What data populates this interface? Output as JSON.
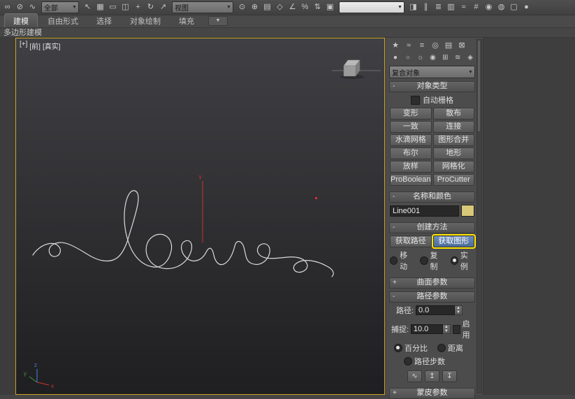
{
  "toolbar": {
    "group1": [
      {
        "name": "select-and-link-icon",
        "glyph": "∞"
      },
      {
        "name": "unlink-selection-icon",
        "glyph": "⊘"
      },
      {
        "name": "bind-to-space-warp-icon",
        "glyph": "∿"
      }
    ],
    "selection_filter": {
      "value": "全部"
    },
    "group2": [
      {
        "name": "select-object-icon",
        "glyph": "↖"
      },
      {
        "name": "select-by-name-icon",
        "glyph": "▦"
      },
      {
        "name": "selection-region-icon",
        "glyph": "▭"
      },
      {
        "name": "window-crossing-icon",
        "glyph": "◫"
      },
      {
        "name": "select-and-move-icon",
        "glyph": "+"
      },
      {
        "name": "select-and-rotate-icon",
        "glyph": "↻"
      },
      {
        "name": "select-and-scale-icon",
        "glyph": "↗"
      }
    ],
    "coord_system": {
      "value": "视图"
    },
    "group3a": [
      {
        "name": "use-pivot-center-icon",
        "glyph": "⊙"
      },
      {
        "name": "select-and-manipulate-icon",
        "glyph": "⊕"
      },
      {
        "name": "keyboard-override-icon",
        "glyph": "▤"
      },
      {
        "name": "snap-toggle-icon",
        "glyph": "◇"
      },
      {
        "name": "angle-snap-icon",
        "glyph": "∠"
      },
      {
        "name": "percent-snap-icon",
        "glyph": "%"
      },
      {
        "name": "spinner-snap-icon",
        "glyph": "⇅"
      },
      {
        "name": "named-sets-icon",
        "glyph": "▣"
      }
    ],
    "named_sets": {
      "value": ""
    },
    "group3b": [
      {
        "name": "mirror-icon",
        "glyph": "◨"
      },
      {
        "name": "align-icon",
        "glyph": "∥"
      },
      {
        "name": "layer-manager-icon",
        "glyph": "≣"
      },
      {
        "name": "ribbon-toggle-icon",
        "glyph": "▥"
      },
      {
        "name": "curve-editor-icon",
        "glyph": "≈"
      },
      {
        "name": "schematic-view-icon",
        "glyph": "#"
      },
      {
        "name": "material-editor-icon",
        "glyph": "◉"
      },
      {
        "name": "render-setup-icon",
        "glyph": "◍"
      },
      {
        "name": "rendered-frame-icon",
        "glyph": "▢"
      },
      {
        "name": "render-icon",
        "glyph": "●"
      }
    ]
  },
  "ribbon": {
    "tabs": [
      "建模",
      "自由形式",
      "选择",
      "对象绘制",
      "填充"
    ],
    "subtitle": "多边形建模"
  },
  "viewport": {
    "menu_plus": "[+]",
    "menu_view": "[前]",
    "menu_shading": "[真实]",
    "axis_x": "x",
    "axis_y": "y",
    "axis_z": "z",
    "pivot_axis": "Y"
  },
  "panel": {
    "tabs": [
      {
        "name": "tab-create",
        "glyph": "★"
      },
      {
        "name": "tab-modify",
        "glyph": "≈"
      },
      {
        "name": "tab-hierarchy",
        "glyph": "≡"
      },
      {
        "name": "tab-motion",
        "glyph": "◎"
      },
      {
        "name": "tab-display",
        "glyph": "▤"
      },
      {
        "name": "tab-utilities",
        "glyph": "⊠"
      }
    ],
    "categories": [
      {
        "name": "category-geometry-icon",
        "glyph": "●"
      },
      {
        "name": "category-shapes-icon",
        "glyph": "○"
      },
      {
        "name": "category-lights-icon",
        "glyph": "☼"
      },
      {
        "name": "category-cameras-icon",
        "glyph": "◉"
      },
      {
        "name": "category-helpers-icon",
        "glyph": "⊞"
      },
      {
        "name": "category-space-warps-icon",
        "glyph": "≋"
      },
      {
        "name": "category-systems-icon",
        "glyph": "◈"
      }
    ],
    "subcategory": "复合对象",
    "object_type": {
      "title": "对象类型",
      "autogrid_label": "自动栅格",
      "buttons": [
        "变形",
        "散布",
        "一致",
        "连接",
        "水滴网格",
        "图形合并",
        "布尔",
        "地形",
        "放样",
        "网格化",
        "ProBoolean",
        "ProCutter"
      ]
    },
    "name_color": {
      "title": "名称和颜色",
      "object_name": "Line001",
      "swatch_color": "#d8c878"
    },
    "creation_method": {
      "title": "创建方法",
      "get_path": "获取路径",
      "get_shape": "获取图形",
      "move": "移动",
      "copy": "复制",
      "instance": "实例",
      "selected": "实例"
    },
    "surface_params": {
      "title": "曲面参数"
    },
    "path_params": {
      "title": "路径参数",
      "path_label": "路径:",
      "path_value": "0.0",
      "snap_label": "捕捉:",
      "snap_value": "10.0",
      "enable_label": "启用",
      "percent_label": "百分比",
      "distance_label": "距离",
      "steps_label": "路径步数",
      "selected_mode": "百分比",
      "icons": [
        {
          "name": "spline-pick-icon",
          "glyph": "∿"
        },
        {
          "name": "arrow-up-icon",
          "glyph": "↥"
        },
        {
          "name": "arrow-down-icon",
          "glyph": "↧"
        }
      ]
    },
    "skin_params": {
      "title": "蒙皮参数"
    }
  },
  "colors": {
    "highlight_outline": "#ffe400",
    "active_button_bg": "#4c6c99",
    "viewport_border": "#c9a322",
    "axis_red": "#cc3333",
    "spline_color": "#dadada"
  }
}
